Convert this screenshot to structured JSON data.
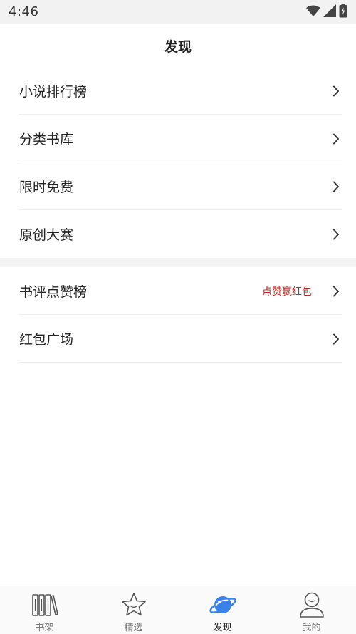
{
  "status_bar": {
    "time": "4:46",
    "icons": [
      "wifi-icon",
      "signal-icon",
      "battery-icon"
    ]
  },
  "header": {
    "title": "发现"
  },
  "menu_groups": [
    {
      "items": [
        {
          "label": "小说排行榜",
          "badge": ""
        },
        {
          "label": "分类书库",
          "badge": ""
        },
        {
          "label": "限时免费",
          "badge": ""
        },
        {
          "label": "原创大赛",
          "badge": ""
        }
      ]
    },
    {
      "items": [
        {
          "label": "书评点赞榜",
          "badge": "点赞赢红包"
        },
        {
          "label": "红包广场",
          "badge": ""
        }
      ]
    }
  ],
  "tab_bar": {
    "active": "发现",
    "tabs": [
      {
        "label": "书架",
        "icon": "bookshelf-icon"
      },
      {
        "label": "精选",
        "icon": "star-icon"
      },
      {
        "label": "发现",
        "icon": "planet-icon"
      },
      {
        "label": "我的",
        "icon": "profile-icon"
      }
    ]
  },
  "colors": {
    "accent": "#3b82e8",
    "badge": "#b2302a",
    "inactive_icon": "#555555"
  }
}
